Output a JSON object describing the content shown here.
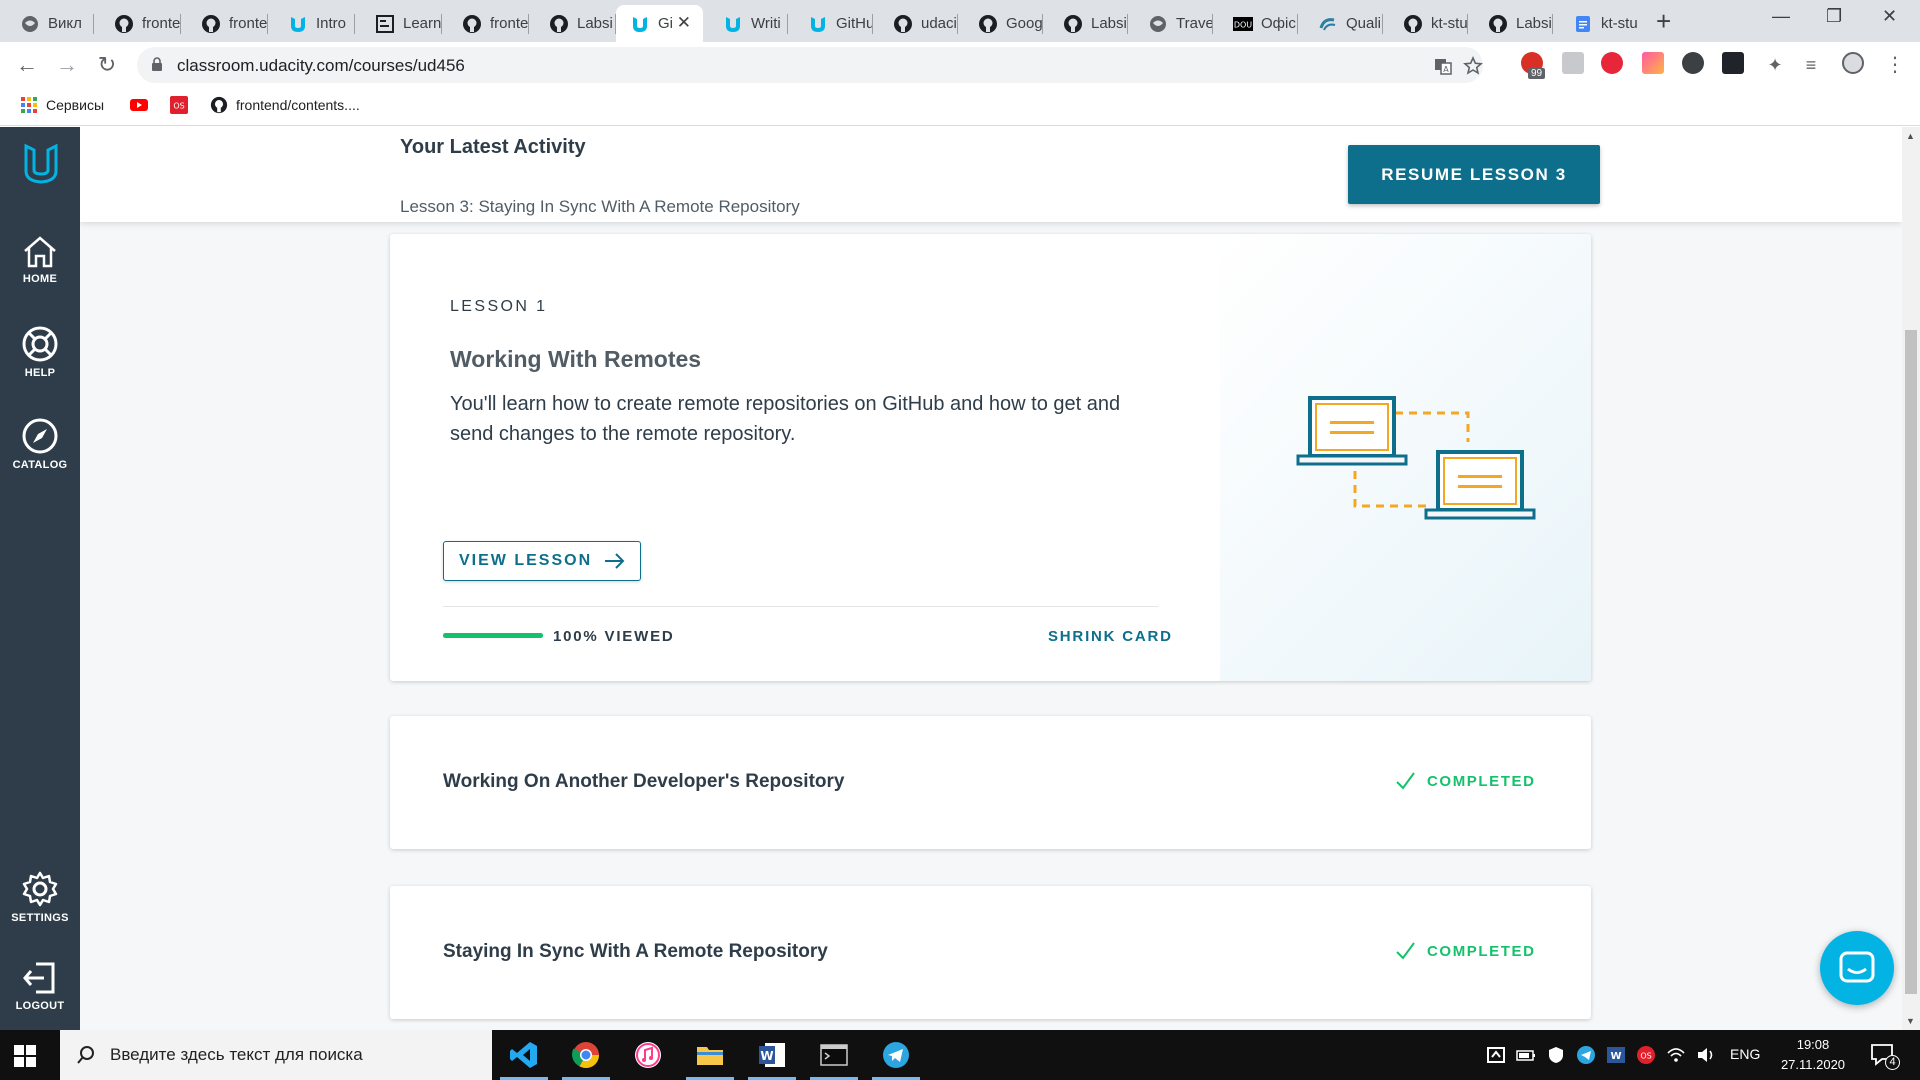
{
  "browser": {
    "tabs": [
      {
        "label": "Викл",
        "icon": "globe"
      },
      {
        "label": "fronte",
        "icon": "github"
      },
      {
        "label": "fronte",
        "icon": "github"
      },
      {
        "label": "Intro",
        "icon": "udacity"
      },
      {
        "label": "Learn",
        "icon": "doc"
      },
      {
        "label": "fronte",
        "icon": "github"
      },
      {
        "label": "Labsi",
        "icon": "github"
      },
      {
        "label": "Gi",
        "icon": "udacity",
        "active": true
      },
      {
        "label": "Writi",
        "icon": "udacity"
      },
      {
        "label": "GitHu",
        "icon": "udacity"
      },
      {
        "label": "udaci",
        "icon": "github"
      },
      {
        "label": "Goog",
        "icon": "github"
      },
      {
        "label": "Labsi",
        "icon": "github"
      },
      {
        "label": "Trave",
        "icon": "globe"
      },
      {
        "label": "Офіс",
        "icon": "dou"
      },
      {
        "label": "Quali",
        "icon": "wave"
      },
      {
        "label": "kt-stu",
        "icon": "github"
      },
      {
        "label": "Labsi",
        "icon": "github"
      },
      {
        "label": "kt-stu",
        "icon": "gdocs"
      }
    ],
    "url": "classroom.udacity.com/courses/ud456",
    "ext_badge": "99",
    "bookmarks": [
      {
        "label": "Сервисы",
        "icon": "apps"
      },
      {
        "label": "",
        "icon": "youtube"
      },
      {
        "label": "",
        "icon": "os"
      },
      {
        "label": "frontend/contents....",
        "icon": "github"
      }
    ]
  },
  "sidebar": {
    "items": [
      {
        "label": "HOME"
      },
      {
        "label": "HELP"
      },
      {
        "label": "CATALOG"
      },
      {
        "label": "SETTINGS"
      },
      {
        "label": "LOGOUT"
      }
    ]
  },
  "activity": {
    "title": "Your Latest Activity",
    "subtitle": "Lesson 3: Staying In Sync With A Remote Repository",
    "resume_label": "RESUME LESSON 3"
  },
  "lesson_card": {
    "kicker": "LESSON 1",
    "title": "Working With Remotes",
    "description": "You'll learn how to create remote repositories on GitHub and how to get and send changes to the remote repository.",
    "view_label": "VIEW LESSON",
    "progress_fraction": 1.0,
    "viewed_label": "100% VIEWED",
    "shrink_label": "SHRINK CARD",
    "colors": {
      "teal": "#0d6f8c",
      "progress": "#15c26b",
      "orange": "#f5a623"
    }
  },
  "collapsed_cards": [
    {
      "title": "Working On Another Developer's Repository",
      "status": "COMPLETED"
    },
    {
      "title": "Staying In Sync With A Remote Repository",
      "status": "COMPLETED"
    }
  ],
  "taskbar": {
    "search_placeholder": "Введите здесь текст для поиска",
    "apps": [
      "vscode",
      "chrome",
      "itunes",
      "explorer",
      "word",
      "terminal",
      "telegram"
    ],
    "lang": "ENG",
    "time": "19:08",
    "date": "27.11.2020",
    "notif_count": "4"
  }
}
